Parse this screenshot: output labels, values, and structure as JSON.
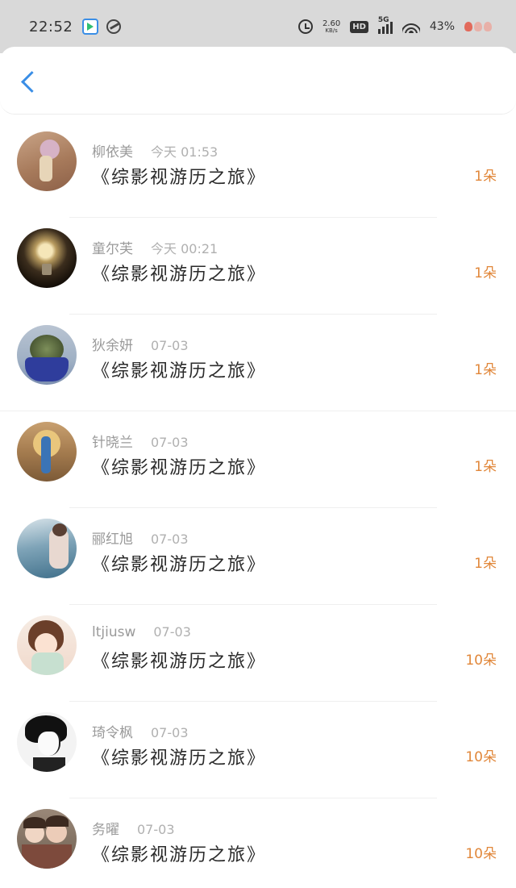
{
  "status_bar": {
    "time": "22:52",
    "net_speed_value": "2.60",
    "net_speed_unit": "KB/s",
    "hd_label": "HD",
    "network_label": "5G",
    "battery": "43%"
  },
  "header": {
    "back_icon": "chevron-left-icon"
  },
  "colors": {
    "accent": "#3a8ee6",
    "amount": "#e1873a",
    "status_bar_bg": "#d9d9d9"
  },
  "items": [
    {
      "name": "柳依美",
      "date": "今天 01:53",
      "title": "《综影视游历之旅》",
      "amount": "1朵"
    },
    {
      "name": "童尔芙",
      "date": "今天 00:21",
      "title": "《综影视游历之旅》",
      "amount": "1朵"
    },
    {
      "name": "狄余妍",
      "date": "07-03",
      "title": "《综影视游历之旅》",
      "amount": "1朵"
    },
    {
      "name": "针晓兰",
      "date": "07-03",
      "title": "《综影视游历之旅》",
      "amount": "1朵"
    },
    {
      "name": "郦红旭",
      "date": "07-03",
      "title": "《综影视游历之旅》",
      "amount": "1朵"
    },
    {
      "name": "ltjiusw",
      "date": "07-03",
      "title": "《综影视游历之旅》",
      "amount": "10朵"
    },
    {
      "name": "琦令枫",
      "date": "07-03",
      "title": "《综影视游历之旅》",
      "amount": "10朵"
    },
    {
      "name": "务曜",
      "date": "07-03",
      "title": "《综影视游历之旅》",
      "amount": "10朵"
    }
  ]
}
